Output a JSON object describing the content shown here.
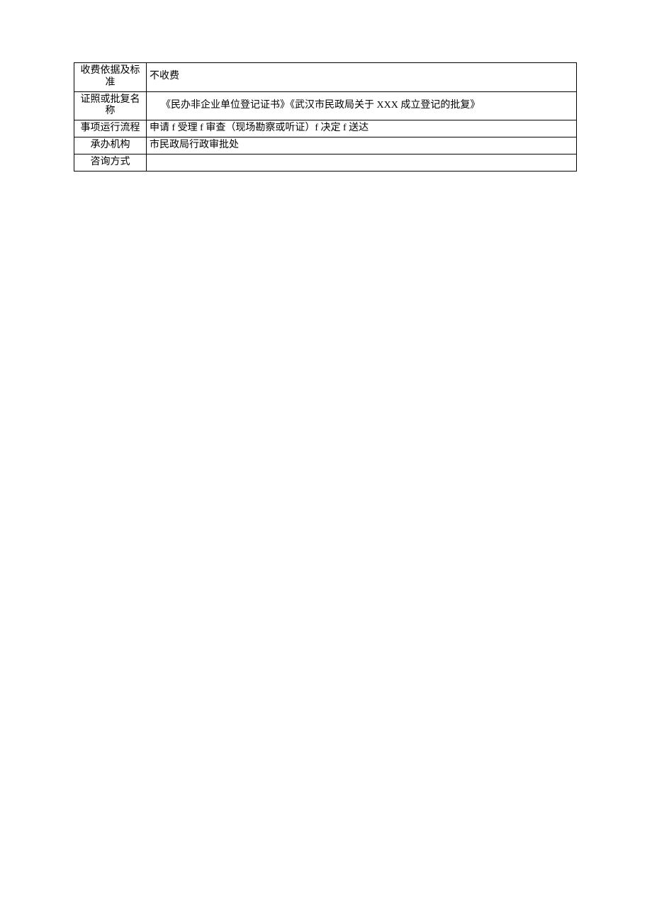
{
  "rows": [
    {
      "label": "收费依据及标准",
      "value": "不收费"
    },
    {
      "label": "证照或批复名称",
      "value": "《民办非企业单位登记证书》《武汉市民政局关于 XXX 成立登记的批复》"
    },
    {
      "label": "事项运行流程",
      "value": "申请 f 受理 f 审查（现场勘察或听证）f 决定 f 送达"
    },
    {
      "label": "承办机构",
      "value": "市民政局行政审批处"
    },
    {
      "label": "咨询方式",
      "value": ""
    }
  ]
}
